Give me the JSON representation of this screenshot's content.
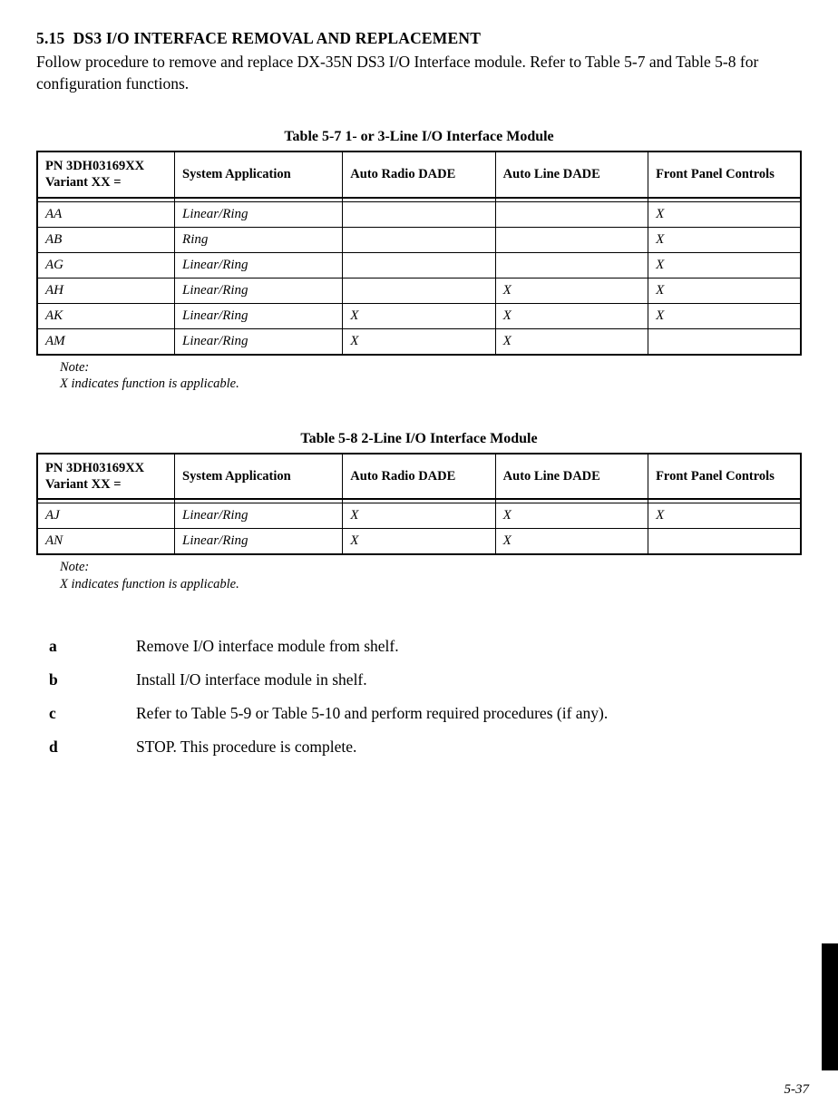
{
  "section": {
    "number": "5.15",
    "title": "DS3 I/O INTERFACE REMOVAL AND REPLACEMENT",
    "intro": "Follow procedure to remove and replace DX-35N DS3 I/O Interface module. Refer to Table 5-7 and Table 5-8 for configuration functions."
  },
  "table_a": {
    "caption": "Table 5-7   1- or 3-Line I/O Interface Module",
    "headers": {
      "pn": "PN 3DH03169XX Variant XX =",
      "app": "System Application",
      "rad": "Auto Radio DADE",
      "line": "Auto Line DADE",
      "fp": "Front Panel Controls"
    },
    "rows": [
      {
        "pn": "AA",
        "app": "Linear/Ring",
        "rad": "",
        "line": "",
        "fp": "X"
      },
      {
        "pn": "AB",
        "app": "Ring",
        "rad": "",
        "line": "",
        "fp": "X"
      },
      {
        "pn": "AG",
        "app": "Linear/Ring",
        "rad": "",
        "line": "",
        "fp": "X"
      },
      {
        "pn": "AH",
        "app": "Linear/Ring",
        "rad": "",
        "line": "X",
        "fp": "X"
      },
      {
        "pn": "AK",
        "app": "Linear/Ring",
        "rad": "X",
        "line": "X",
        "fp": "X"
      },
      {
        "pn": "AM",
        "app": "Linear/Ring",
        "rad": "X",
        "line": "X",
        "fp": ""
      }
    ],
    "note_label": "Note:",
    "note_text": "X indicates function is applicable."
  },
  "table_b": {
    "caption": "Table 5-8   2-Line I/O Interface Module",
    "headers": {
      "pn": "PN 3DH03169XX Variant XX =",
      "app": "System Application",
      "rad": "Auto Radio DADE",
      "line": "Auto Line DADE",
      "fp": "Front Panel Controls"
    },
    "rows": [
      {
        "pn": "AJ",
        "app": "Linear/Ring",
        "rad": "X",
        "line": "X",
        "fp": "X"
      },
      {
        "pn": "AN",
        "app": "Linear/Ring",
        "rad": "X",
        "line": "X",
        "fp": ""
      }
    ],
    "note_label": "Note:",
    "note_text": "X indicates function is applicable."
  },
  "steps": [
    {
      "letter": "a",
      "text": "Remove I/O interface module from shelf."
    },
    {
      "letter": "b",
      "text": "Install I/O interface module in shelf."
    },
    {
      "letter": "c",
      "text": "Refer to Table 5-9 or Table 5-10 and perform required procedures (if any)."
    },
    {
      "letter": "d",
      "text": "STOP. This procedure is complete."
    }
  ],
  "page_number": "5-37"
}
